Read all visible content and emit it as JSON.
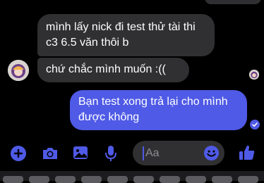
{
  "messages": {
    "incoming_1_line1": "mình lấy nick đi test thử tài thi",
    "incoming_1_line2": "c3 6.5 văn thôi b",
    "incoming_2": "chứ chắc mình muốn :((",
    "outgoing_line1": "Bạn test xong trả lại cho mình",
    "outgoing_line2": "được không"
  },
  "composer": {
    "placeholder": "Aa"
  },
  "colors": {
    "background": "#000000",
    "incoming_bubble": "#303032",
    "outgoing_bubble": "#4f5ae6",
    "accent": "#4f5ae6"
  },
  "icons": [
    "plus-icon",
    "camera-icon",
    "image-icon",
    "microphone-icon",
    "emoji-icon",
    "like-icon",
    "seen-check-icon"
  ]
}
